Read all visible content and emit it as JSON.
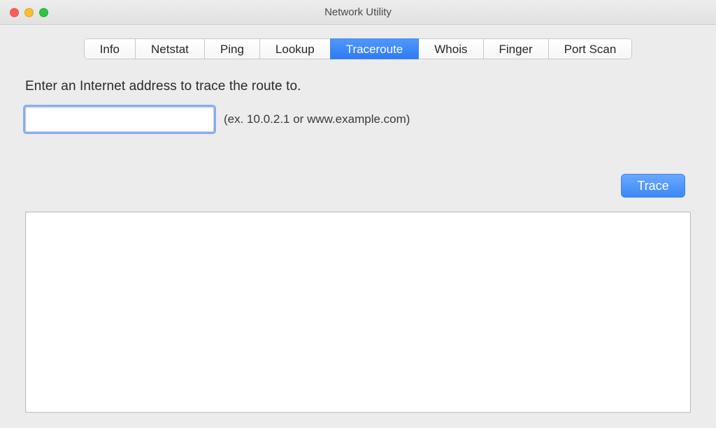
{
  "window": {
    "title": "Network Utility"
  },
  "tabs": {
    "info": "Info",
    "netstat": "Netstat",
    "ping": "Ping",
    "lookup": "Lookup",
    "traceroute": "Traceroute",
    "whois": "Whois",
    "finger": "Finger",
    "portscan": "Port Scan"
  },
  "body": {
    "prompt": "Enter an Internet address to trace the route to.",
    "input_value": "",
    "hint": "(ex. 10.0.2.1 or www.example.com)",
    "trace_button": "Trace",
    "output": ""
  }
}
